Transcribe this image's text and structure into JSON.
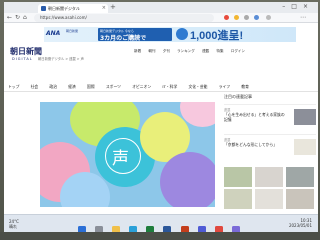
{
  "browser": {
    "tab_title": "朝日新聞デジタル",
    "url": "https://www.asahi.com/"
  },
  "ad": {
    "brand": "ANA",
    "brand_sub": "朝日新聞",
    "offer_caption": "朝日新聞デジタル 今なら",
    "offer_text": "3カ月のご購読で",
    "headline": "1,000進呈!"
  },
  "site": {
    "logo": "朝日新聞",
    "logo_sub": "DIGITAL",
    "header_links": [
      "新着",
      "朝刊",
      "夕刊",
      "ランキング",
      "連載",
      "特集",
      "ログイン"
    ],
    "nav": [
      "トップ",
      "社会",
      "政治",
      "経済",
      "国際",
      "スポーツ",
      "オピニオン",
      "IT・科学",
      "文化・芸能",
      "ライフ",
      "教育"
    ],
    "breadcrumb": "朝日新聞デジタル > 連載 > 声"
  },
  "hero": {
    "kanji": "声"
  },
  "sidebar": {
    "title": "注目の連載記事",
    "articles": [
      {
        "category": "連載",
        "headline": "「心を生み出せる」と考える家族の記憶"
      },
      {
        "category": "連載",
        "headline": "「京都をどんな形にしてから」"
      }
    ]
  },
  "taskbar": {
    "weather_temp": "24°C",
    "weather_condition": "晴れ",
    "time": "10:31",
    "date": "2023/05/01"
  },
  "colors": {
    "brand_navy": "#1e2a6b",
    "ad_blue": "#1d57a6",
    "hero_bg": "#8dc7e9"
  }
}
